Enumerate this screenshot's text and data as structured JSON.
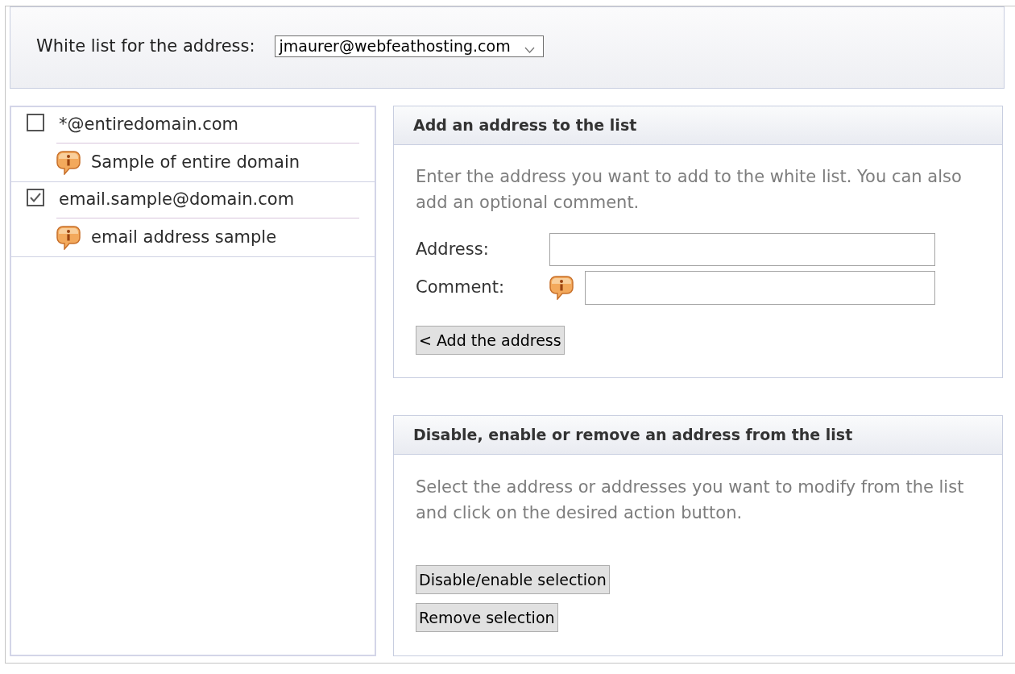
{
  "header": {
    "label": "White list for the address:",
    "select": {
      "value": "jmaurer@webfeathosting.com"
    }
  },
  "entries": [
    {
      "address": "*@entiredomain.com",
      "checked": false,
      "comment": "Sample of entire domain"
    },
    {
      "address": "email.sample@domain.com",
      "checked": true,
      "comment": "email address sample"
    }
  ],
  "add_panel": {
    "title": "Add an address to the list",
    "description": "Enter the address you want to add to the white list. You can also add an optional comment.",
    "fields": [
      {
        "label": "Address:",
        "kind": "plain"
      },
      {
        "label": "Comment:",
        "kind": "with_info"
      }
    ],
    "button": "< Add the address"
  },
  "modify_panel": {
    "title": "Disable, enable or remove an address from the list",
    "description": "Select the address or addresses you want to modify from the list and click on the desired action button.",
    "buttons": [
      "Disable/enable selection",
      "Remove selection"
    ]
  }
}
